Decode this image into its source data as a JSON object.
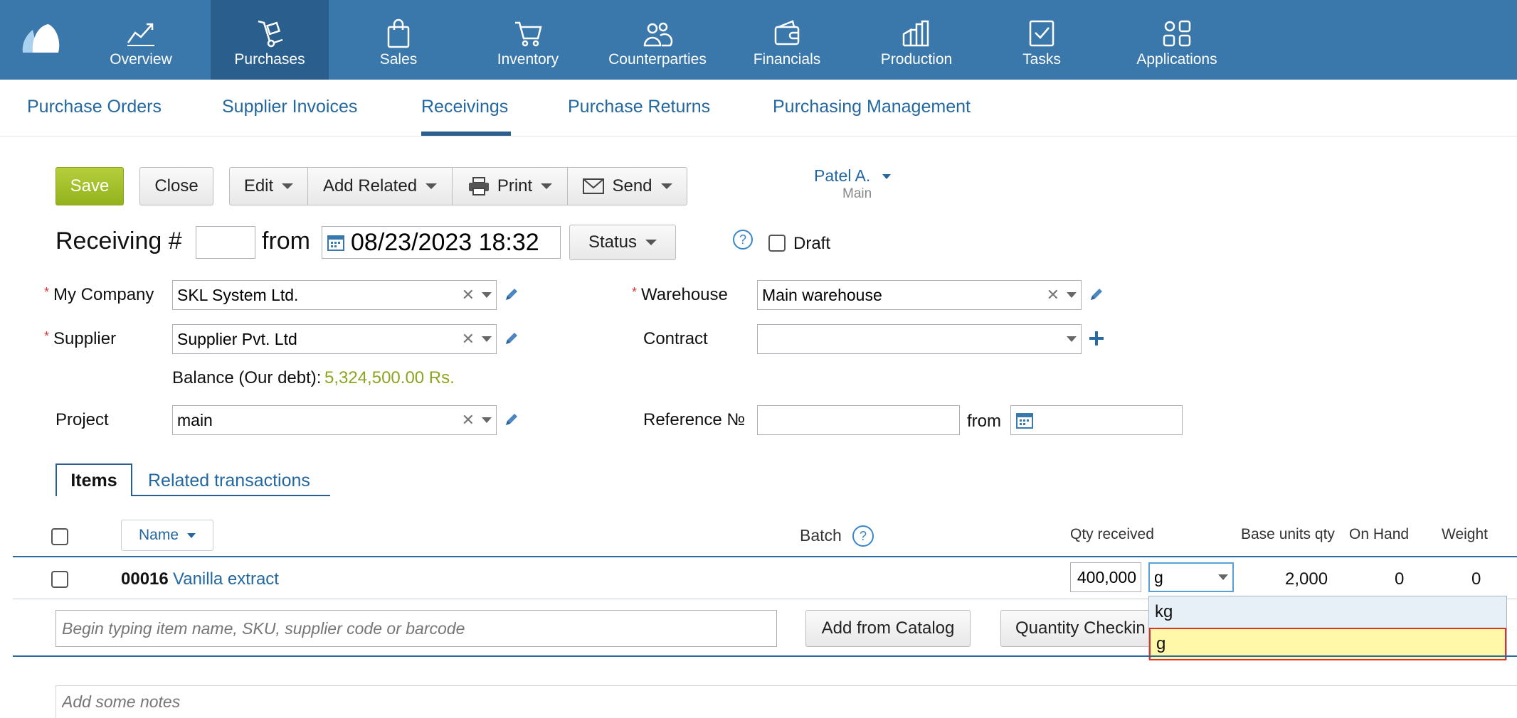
{
  "nav": {
    "items": [
      {
        "label": "Overview",
        "icon": "chart-line-icon"
      },
      {
        "label": "Purchases",
        "icon": "hand-truck-icon"
      },
      {
        "label": "Sales",
        "icon": "shopping-bag-icon"
      },
      {
        "label": "Inventory",
        "icon": "cart-icon"
      },
      {
        "label": "Counterparties",
        "icon": "people-icon"
      },
      {
        "label": "Financials",
        "icon": "wallet-icon"
      },
      {
        "label": "Production",
        "icon": "factory-icon"
      },
      {
        "label": "Tasks",
        "icon": "checkbox-icon"
      },
      {
        "label": "Applications",
        "icon": "apps-grid-icon"
      }
    ],
    "active": "Purchases",
    "accent": "#3a77aa"
  },
  "subnav": {
    "tabs": [
      "Purchase Orders",
      "Supplier Invoices",
      "Receivings",
      "Purchase Returns",
      "Purchasing Management"
    ],
    "active": "Receivings"
  },
  "toolbar": {
    "save": "Save",
    "close": "Close",
    "edit": "Edit",
    "add_related": "Add Related",
    "print": "Print",
    "send": "Send"
  },
  "user": {
    "name": "Patel A.",
    "role": "Main"
  },
  "doc": {
    "title": "Receiving #",
    "number": "",
    "from": "from",
    "datetime": "08/23/2023 18:32",
    "status": "Status",
    "help": "?",
    "draft": "Draft"
  },
  "form": {
    "my_company_label": "My Company",
    "my_company": "SKL System Ltd.",
    "warehouse_label": "Warehouse",
    "warehouse": "Main warehouse",
    "supplier_label": "Supplier",
    "supplier": "Supplier Pvt. Ltd",
    "contract_label": "Contract",
    "contract": "",
    "balance_label": "Balance (Our debt):",
    "balance_value": "5,324,500.00 Rs.",
    "balance_color": "#8aa51e",
    "project_label": "Project",
    "project": "main",
    "reference_label": "Reference №",
    "reference": "",
    "ref_from": "from",
    "ref_date": ""
  },
  "tabs": {
    "items": "Items",
    "related": "Related transactions"
  },
  "table": {
    "headers": {
      "name": "Name",
      "batch": "Batch",
      "qty_received": "Qty received",
      "base_units_qty": "Base units qty",
      "on_hand": "On Hand",
      "weight": "Weight"
    },
    "rows": [
      {
        "code": "00016",
        "name": "Vanilla extract",
        "qty": "400,000",
        "unit": "g",
        "base_qty": "2,000",
        "on_hand": "0",
        "weight": "0"
      }
    ]
  },
  "add_item": {
    "placeholder": "Begin typing item name, SKU, supplier code or barcode",
    "add_from_catalog": "Add from Catalog",
    "quantity_checking": "Quantity Checkin"
  },
  "unit_dropdown": {
    "options": [
      "kg",
      "g"
    ],
    "selected": "g"
  },
  "notes": {
    "placeholder": "Add some notes"
  }
}
